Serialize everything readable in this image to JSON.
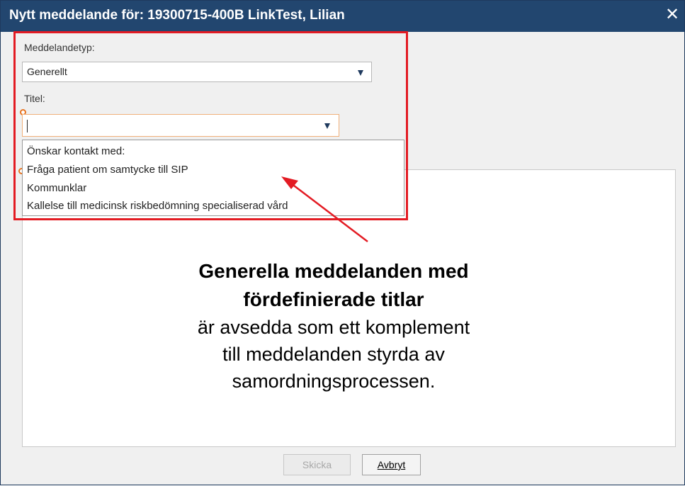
{
  "dialog": {
    "title": "Nytt meddelande för: 19300715-400B LinkTest, Lilian",
    "close_glyph": "✕"
  },
  "form": {
    "message_type_label": "Meddelandetyp:",
    "message_type_value": "Generellt",
    "title_label": "Titel:",
    "title_value": ""
  },
  "dropdown": {
    "options": [
      "Önskar kontakt med:",
      "Fråga patient om samtycke till SIP",
      "Kommunklar",
      "Kallelse till medicinsk riskbedömning specialiserad vård"
    ]
  },
  "annotation": {
    "bold_line_1": "Generella meddelanden med",
    "bold_line_2": "fördefinierade titlar",
    "line_1": "är avsedda som ett komplement",
    "line_2": "till meddelanden styrda av",
    "line_3": "samordningsprocessen."
  },
  "buttons": {
    "send_label": "Skicka",
    "cancel_label": "Avbryt"
  },
  "colors": {
    "titlebar": "#22466f",
    "highlight": "#e31b23",
    "required_marker": "#e8731f"
  },
  "icons": {
    "close": "close-icon",
    "dropdown": "chevron-down-icon",
    "required": "required-marker-icon"
  }
}
